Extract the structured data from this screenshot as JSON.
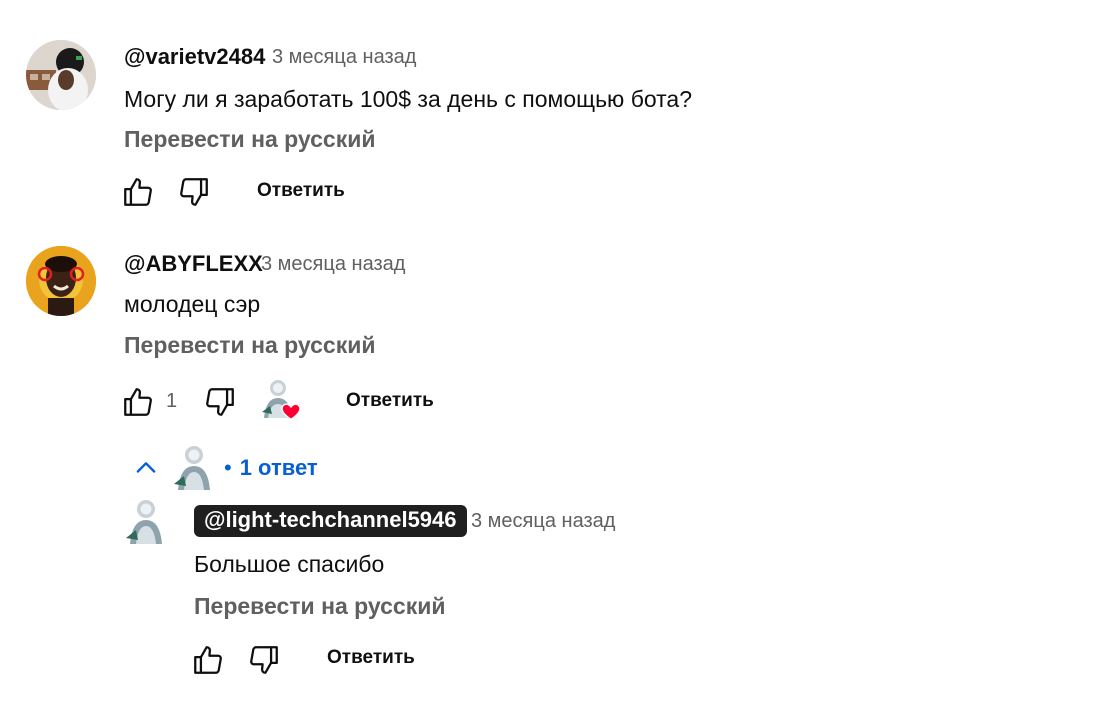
{
  "comments": [
    {
      "username": "@varietv2484",
      "time": "3 месяца назад",
      "text": "Могу ли я заработать 100$ за день с помощью бота?",
      "translate_label": "Перевести на русский",
      "reply_label": "Ответить"
    },
    {
      "username": "@ABYFLEXX",
      "time": "3 месяца назад",
      "text": "молодец сэр",
      "translate_label": "Перевести на русский",
      "like_count": "1",
      "reply_label": "Ответить",
      "replies_toggle_label": "1 ответ",
      "replies_separator": "•",
      "replies": [
        {
          "username": "@light-techchannel5946",
          "time": "3 месяца назад",
          "text": "Большое спасибо",
          "translate_label": "Перевести на русский",
          "reply_label": "Ответить"
        }
      ]
    }
  ],
  "colors": {
    "link_blue": "#065fd4",
    "heart_red": "#ff0033",
    "secondary_text": "#606060",
    "owner_chip_bg": "#1f1f1f"
  },
  "icons": {
    "like": "thumbs-up-icon",
    "dislike": "thumbs-down-icon",
    "heart": "heart-icon",
    "collapse": "chevron-up-icon"
  }
}
